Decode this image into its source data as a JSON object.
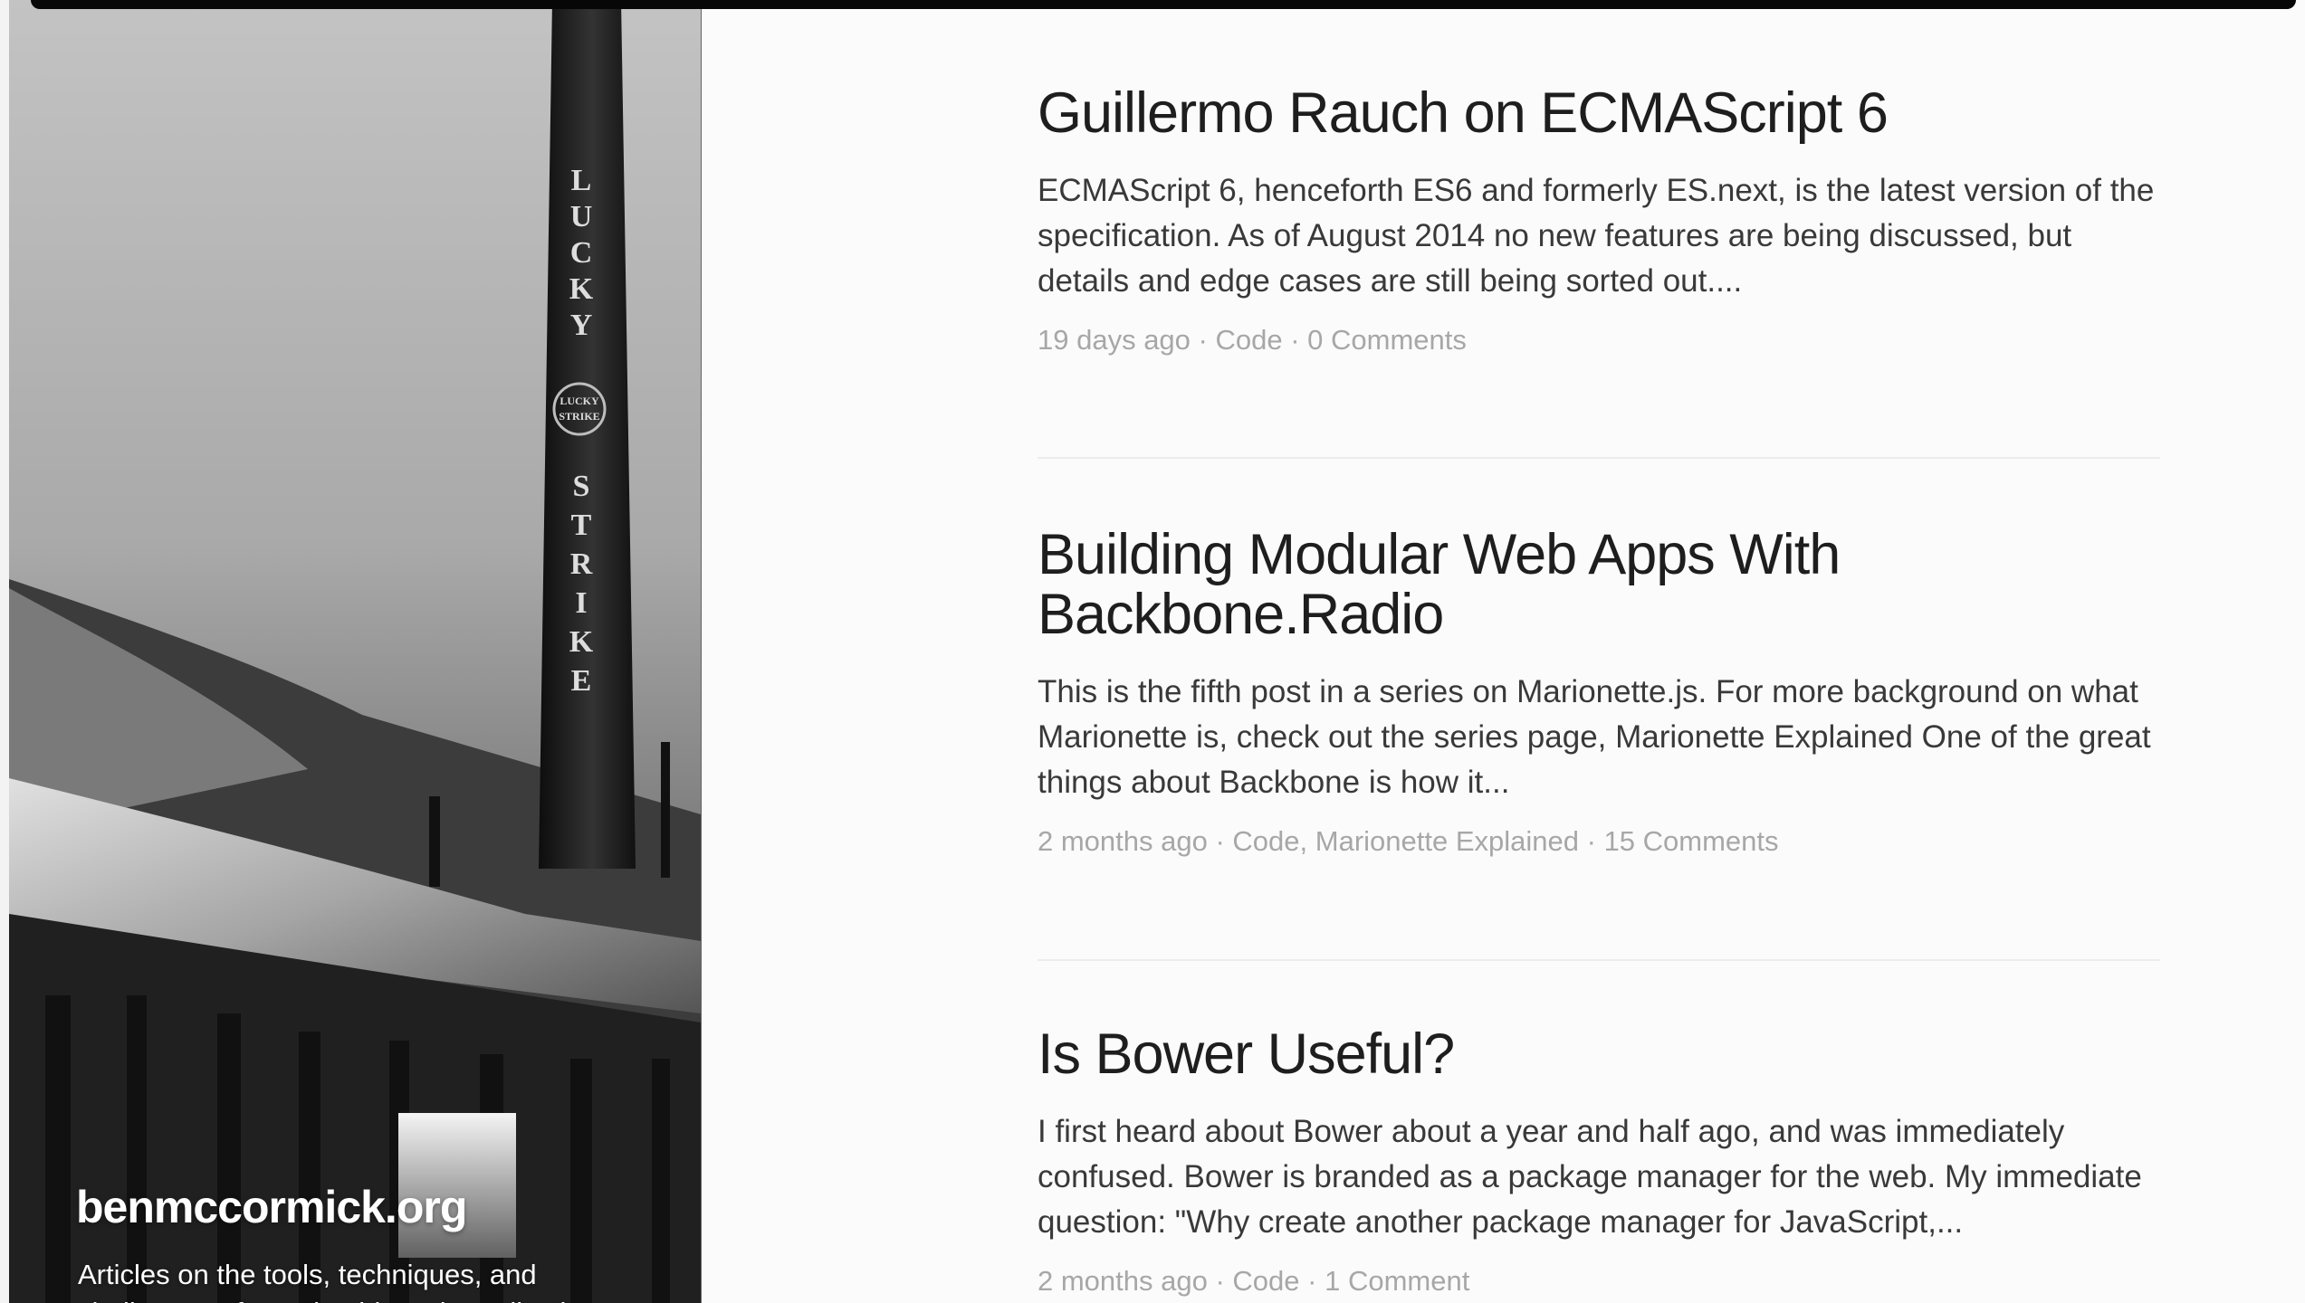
{
  "site": {
    "title": "benmccormick.org",
    "tagline": "Articles on the tools, techniques, and challenges of creating big web applications"
  },
  "posts": [
    {
      "title": "Guillermo Rauch on ECMAScript 6",
      "excerpt": "ECMAScript 6, henceforth ES6 and formerly ES.next, is the latest version of the specification. As of August 2014 no new features are being discussed, but details and edge cases are still being sorted out....",
      "date": "19 days ago",
      "categories": "Code",
      "comments": "0 Comments"
    },
    {
      "title": "Building Modular Web Apps With Backbone.Radio",
      "excerpt": "This is the fifth post in a series on Marionette.js. For more background on what Marionette is, check out the series page, Marionette Explained One of the great things about Backbone is how it...",
      "date": "2 months ago",
      "categories": "Code, Marionette Explained",
      "comments": "15 Comments"
    },
    {
      "title": "Is Bower Useful?",
      "excerpt": "I first heard about Bower about a year and half ago, and was immediately confused. Bower is branded as a package manager for the web. My immediate question: \"Why create another package manager for JavaScript,...",
      "date": "2 months ago",
      "categories": "Code",
      "comments": "1 Comment"
    }
  ],
  "meta_separator": " · ",
  "hero_image": {
    "chimney_upper_text": "LUCKY",
    "chimney_lower_text": "STRIKE",
    "badge_text": [
      "LUCKY",
      "STRIKE"
    ]
  },
  "colors": {
    "meta_gray": "#a7a7a7",
    "title": "#1e1e1e",
    "excerpt": "#393939"
  }
}
